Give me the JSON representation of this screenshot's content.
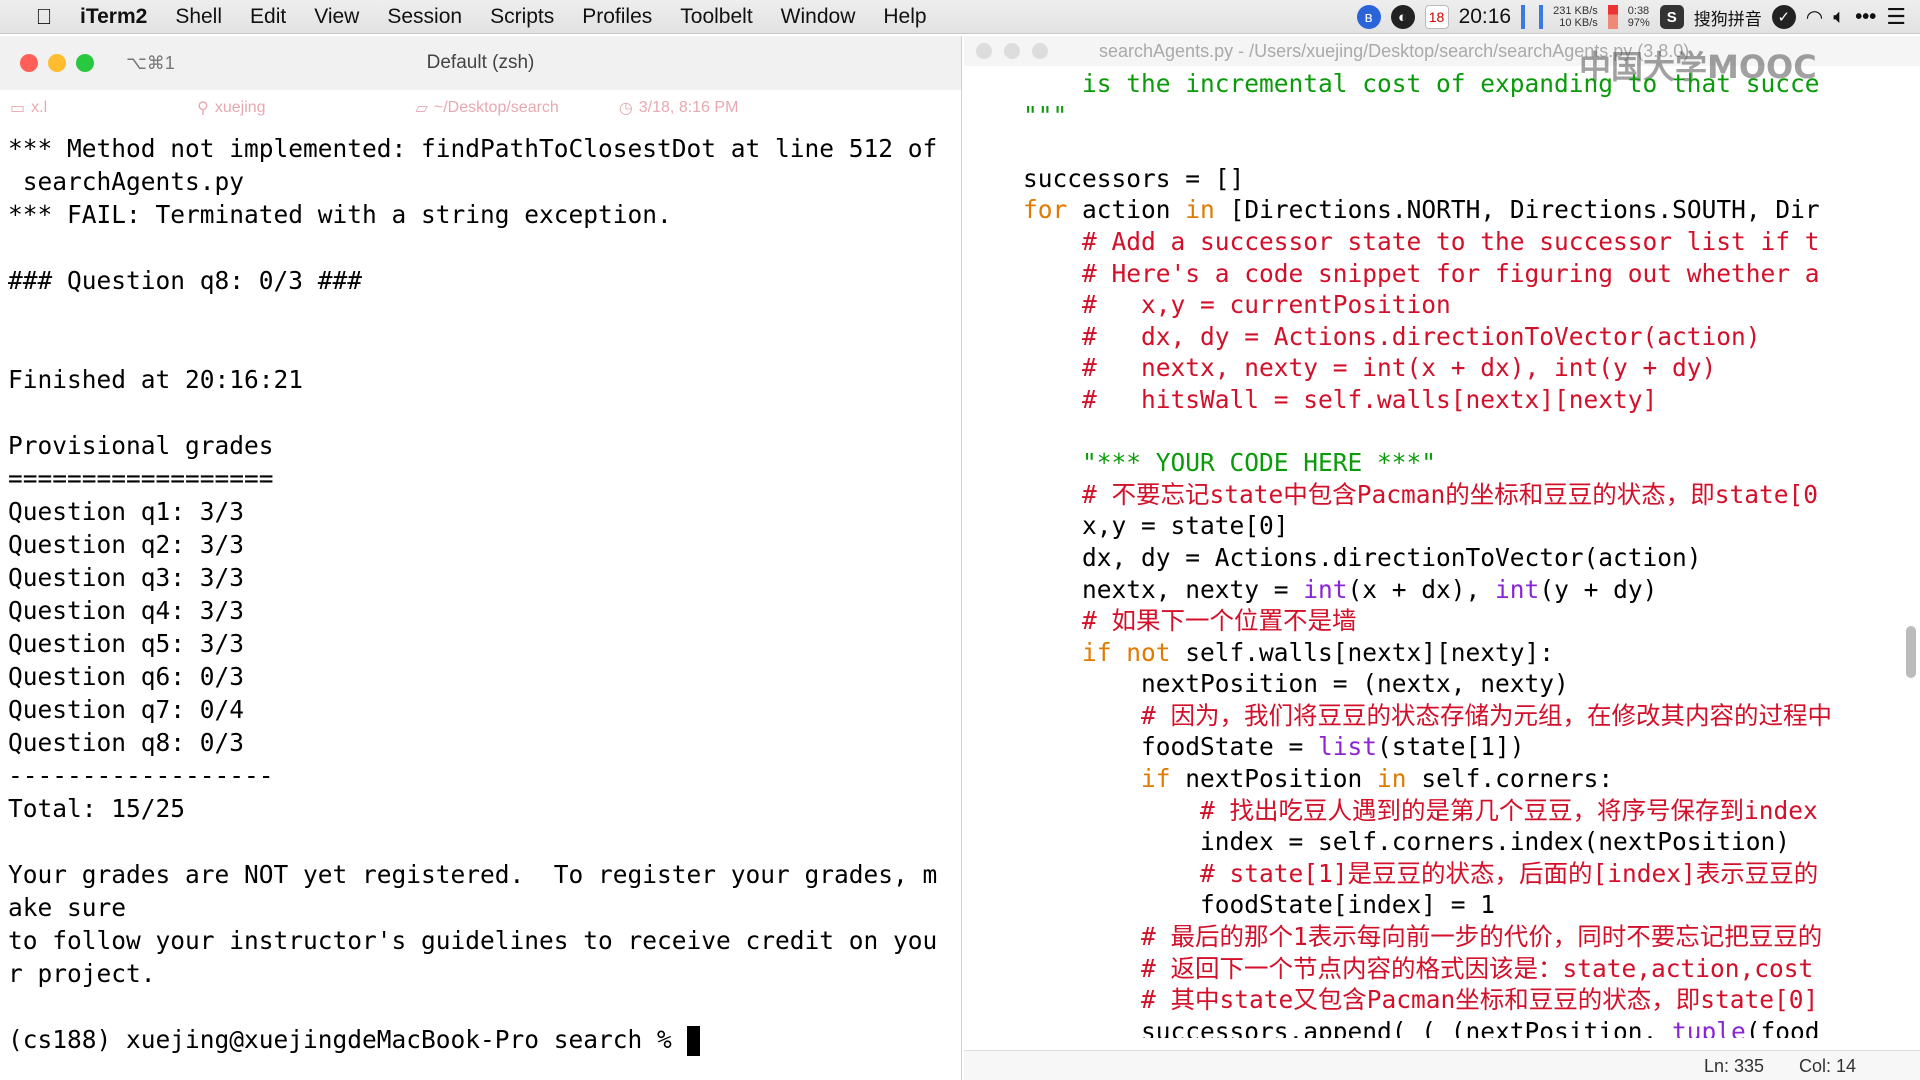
{
  "menubar": {
    "app": "iTerm2",
    "items": [
      "Shell",
      "Edit",
      "View",
      "Session",
      "Scripts",
      "Profiles",
      "Toolbelt",
      "Window",
      "Help"
    ],
    "status": {
      "date_badge": "18",
      "time": "20:16",
      "net_up": "231 KB/s",
      "net_down": "10 KB/s",
      "battery_time": "0:38",
      "battery_pct": "97%",
      "ime": "搜狗拼音"
    }
  },
  "terminal": {
    "title": "Default (zsh)",
    "shortcut": "⌥⌘1",
    "badges": {
      "host": "x.l",
      "user": "xuejing",
      "dir": "~/Desktop/search",
      "time": "3/18, 8:16 PM"
    },
    "lines": [
      "*** Method not implemented: findPathToClosestDot at line 512 of",
      " searchAgents.py",
      "*** FAIL: Terminated with a string exception.",
      "",
      "### Question q8: 0/3 ###",
      "",
      "",
      "Finished at 20:16:21",
      "",
      "Provisional grades",
      "==================",
      "Question q1: 3/3",
      "Question q2: 3/3",
      "Question q3: 3/3",
      "Question q4: 3/3",
      "Question q5: 3/3",
      "Question q6: 0/3",
      "Question q7: 0/4",
      "Question q8: 0/3",
      "------------------",
      "Total: 15/25",
      "",
      "Your grades are NOT yet registered.  To register your grades, m",
      "ake sure",
      "to follow your instructor's guidelines to receive credit on you",
      "r project.",
      ""
    ],
    "prompt": "(cs188) xuejing@xuejingdeMacBook-Pro search % "
  },
  "editor": {
    "title": "searchAgents.py - /Users/xuejing/Desktop/search/searchAgents.py (3.8.0)",
    "watermark": "中国大学MOOC",
    "code": [
      [
        [
          "        ",
          "plain"
        ],
        [
          "is the incremental cost of expanding to that succe",
          "str"
        ]
      ],
      [
        [
          "    \"\"\"",
          "str"
        ]
      ],
      [
        [
          "",
          "plain"
        ]
      ],
      [
        [
          "    successors = []",
          "plain"
        ]
      ],
      [
        [
          "    ",
          "plain"
        ],
        [
          "for",
          "kw"
        ],
        [
          " action ",
          "plain"
        ],
        [
          "in",
          "kw"
        ],
        [
          " [Directions.NORTH, Directions.SOUTH, Dir",
          "plain"
        ]
      ],
      [
        [
          "        # Add a successor state to the successor list if t",
          "com"
        ]
      ],
      [
        [
          "        # Here's a code snippet for figuring out whether a",
          "com"
        ]
      ],
      [
        [
          "        #   x,y = currentPosition",
          "com"
        ]
      ],
      [
        [
          "        #   dx, dy = Actions.directionToVector(action)",
          "com"
        ]
      ],
      [
        [
          "        #   nextx, nexty = int(x + dx), int(y + dy)",
          "com"
        ]
      ],
      [
        [
          "        #   hitsWall = self.walls[nextx][nexty]",
          "com"
        ]
      ],
      [
        [
          "",
          "plain"
        ]
      ],
      [
        [
          "        \"*** YOUR CODE HERE ***\"",
          "str"
        ]
      ],
      [
        [
          "        # 不要忘记state中包含Pacman的坐标和豆豆的状态，即state[0",
          "com"
        ]
      ],
      [
        [
          "        x,y = state[0]",
          "plain"
        ]
      ],
      [
        [
          "        dx, dy = Actions.directionToVector(action)",
          "plain"
        ]
      ],
      [
        [
          "        nextx, nexty = ",
          "plain"
        ],
        [
          "int",
          "bi"
        ],
        [
          "(x + dx), ",
          "plain"
        ],
        [
          "int",
          "bi"
        ],
        [
          "(y + dy)",
          "plain"
        ]
      ],
      [
        [
          "        # 如果下一个位置不是墙",
          "com"
        ]
      ],
      [
        [
          "        ",
          "plain"
        ],
        [
          "if not",
          "kw"
        ],
        [
          " self.walls[nextx][nexty]:",
          "plain"
        ]
      ],
      [
        [
          "            nextPosition = (nextx, nexty)",
          "plain"
        ]
      ],
      [
        [
          "            # 因为，我们将豆豆的状态存储为元组，在修改其内容的过程中",
          "com"
        ]
      ],
      [
        [
          "            foodState = ",
          "plain"
        ],
        [
          "list",
          "bi"
        ],
        [
          "(state[1])",
          "plain"
        ]
      ],
      [
        [
          "            ",
          "plain"
        ],
        [
          "if",
          "kw"
        ],
        [
          " nextPosition ",
          "plain"
        ],
        [
          "in",
          "kw"
        ],
        [
          " self.corners:",
          "plain"
        ]
      ],
      [
        [
          "                # 找出吃豆人遇到的是第几个豆豆，将序号保存到index",
          "com"
        ]
      ],
      [
        [
          "                index = self.corners.index(nextPosition)",
          "plain"
        ]
      ],
      [
        [
          "                # state[1]是豆豆的状态，后面的[index]表示豆豆的",
          "com"
        ]
      ],
      [
        [
          "                foodState[index] = 1",
          "plain"
        ]
      ],
      [
        [
          "            # 最后的那个1表示每向前一步的代价，同时不要忘记把豆豆的",
          "com"
        ]
      ],
      [
        [
          "            # 返回下一个节点内容的格式因该是：state,action,cost",
          "com"
        ]
      ],
      [
        [
          "            # 其中state又包含Pacman坐标和豆豆的状态，即state[0]",
          "com"
        ]
      ],
      [
        [
          "            successors.append( ( (nextPosition, ",
          "plain"
        ],
        [
          "tuple",
          "bi"
        ],
        [
          "(food",
          "plain"
        ]
      ]
    ],
    "status": {
      "line": "Ln: 335",
      "col": "Col: 14"
    }
  },
  "colors": {
    "close": "#fe5f57",
    "minimize": "#febc2e",
    "zoom": "#28c840",
    "string": "#0a9a0a",
    "keyword": "#e07b00",
    "comment": "#d3102a",
    "builtin": "#8a24d6"
  }
}
